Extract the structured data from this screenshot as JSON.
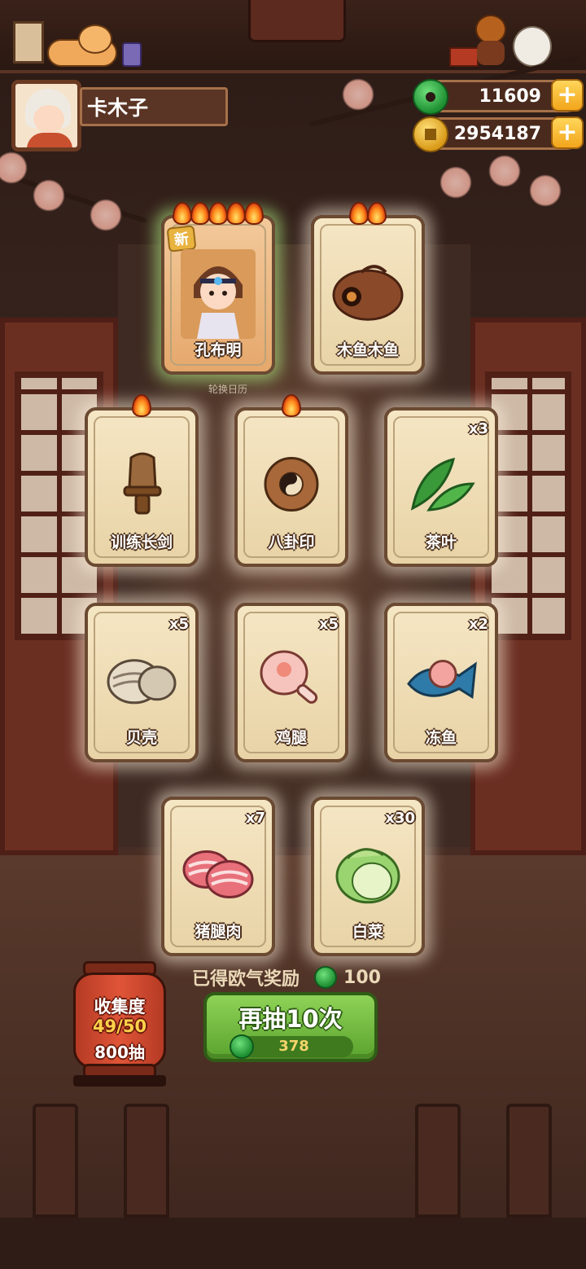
{
  "player": {
    "name": "卡木子"
  },
  "currencies": {
    "jade": "11609",
    "coins": "2954187",
    "plus_label": "+"
  },
  "featured_cards": [
    {
      "name": "孔布明",
      "flames": 5,
      "new_label": "新",
      "quantity": ""
    },
    {
      "name": "木鱼木鱼",
      "flames": 2,
      "quantity": ""
    }
  ],
  "featured_caption": "轮换日历",
  "cards_row2": [
    {
      "name": "训练长剑",
      "flames": 1,
      "quantity": ""
    },
    {
      "name": "八卦印",
      "flames": 1,
      "quantity": ""
    },
    {
      "name": "茶叶",
      "flames": 0,
      "quantity": "x3"
    }
  ],
  "cards_row3": [
    {
      "name": "贝壳",
      "quantity": "x5"
    },
    {
      "name": "鸡腿",
      "quantity": "x5"
    },
    {
      "name": "冻鱼",
      "quantity": "x2"
    }
  ],
  "cards_row4": [
    {
      "name": "猪腿肉",
      "quantity": "x7"
    },
    {
      "name": "白菜",
      "quantity": "x30"
    }
  ],
  "reward": {
    "text": "已得欧气奖励",
    "amount": "100"
  },
  "draw_button": {
    "label": "再抽10次",
    "cost": "378"
  },
  "collection": {
    "title": "收集度",
    "progress": "49/50",
    "draws": "800抽"
  },
  "colors": {
    "accent_green": "#5aa32e",
    "gold": "#f2a51b",
    "panel_brown": "#5a3424"
  }
}
